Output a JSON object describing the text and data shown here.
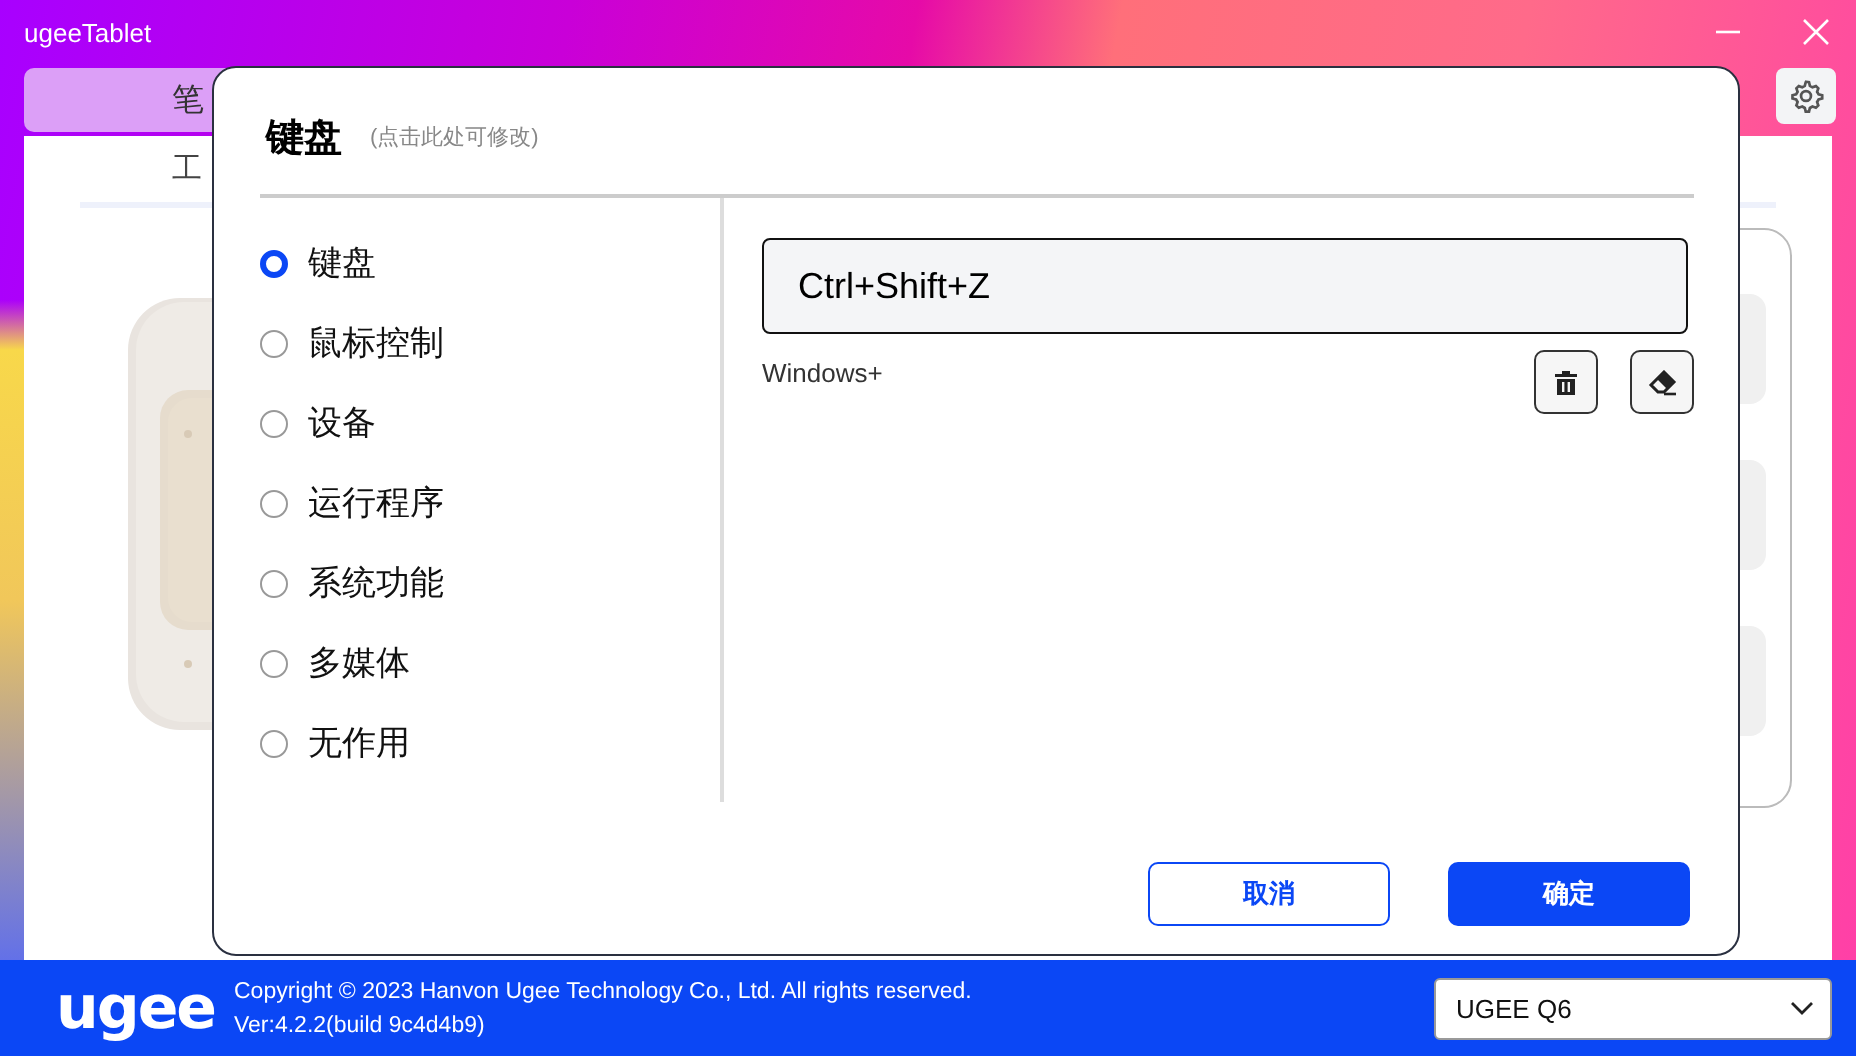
{
  "window": {
    "title": "ugeeTablet"
  },
  "tabs": [
    {
      "label": "笔",
      "selected": true
    }
  ],
  "subtabs": [
    {
      "label": "工",
      "selected": true
    }
  ],
  "dialog": {
    "title": "键盘",
    "hint": "(点击此处可修改)",
    "options": [
      {
        "label": "键盘",
        "selected": true
      },
      {
        "label": "鼠标控制",
        "selected": false
      },
      {
        "label": "设备",
        "selected": false
      },
      {
        "label": "运行程序",
        "selected": false
      },
      {
        "label": "系统功能",
        "selected": false
      },
      {
        "label": "多媒体",
        "selected": false
      },
      {
        "label": "无作用",
        "selected": false
      }
    ],
    "shortcut": {
      "value": "Ctrl+Shift+Z"
    },
    "modifier_label": "Windows+",
    "buttons": [
      {
        "label": "取消",
        "kind": "secondary"
      },
      {
        "label": "确定",
        "kind": "primary"
      }
    ]
  },
  "footer": {
    "logo": "ugee",
    "copyright": "Copyright © 2023 Hanvon Ugee Technology Co., Ltd. All rights reserved.",
    "version": "Ver:4.2.2(build 9c4d4b9)",
    "device": "UGEE Q6"
  }
}
